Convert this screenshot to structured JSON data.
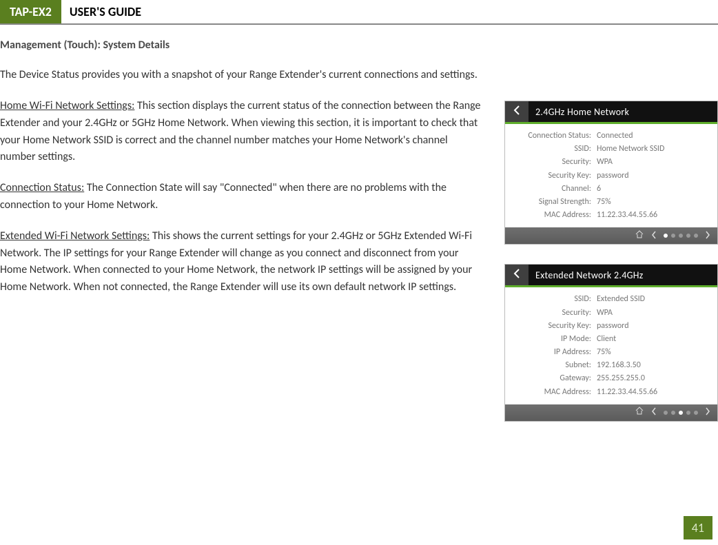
{
  "header": {
    "badge": "TAP-EX2",
    "title": "USER'S GUIDE"
  },
  "section_title": "Management (Touch): System Details",
  "intro": "The Device Status provides you with a snapshot of your Range Extender's current connections and settings.",
  "paras": {
    "p1_label": "Home Wi-Fi Network Settings:",
    "p1_text": " This section displays the current status of the connection between the Range Extender and your 2.4GHz or 5GHz Home Network. When viewing this section, it is important to check that your Home Network SSID is correct and the channel number matches your Home Network's channel number settings.",
    "p2_label": "Connection Status:",
    "p2_text": " The Connection State will say \"Connected\" when there are no problems with the connection to your Home Network.",
    "p3_label": "Extended Wi-Fi Network Settings:",
    "p3_text": " This shows the current settings for your 2.4GHz or 5GHz Extended Wi-Fi Network. The IP settings for your Range Extender will change as you connect and disconnect from your Home Network. When connected to your Home Network, the network IP settings will be assigned by your Home Network. When not connected, the Range Extender will use its own default network IP settings."
  },
  "panel1": {
    "title": "2.4GHz Home Network",
    "rows": [
      {
        "k": "Connection Status:",
        "v": "Connected"
      },
      {
        "k": "SSID:",
        "v": "Home Network SSID"
      },
      {
        "k": "Security:",
        "v": "WPA"
      },
      {
        "k": "Security Key:",
        "v": "password"
      },
      {
        "k": "Channel:",
        "v": "6"
      },
      {
        "k": "Signal Strength:",
        "v": "75%"
      },
      {
        "k": "MAC Address:",
        "v": "11.22.33.44.55.66"
      }
    ],
    "active_dot": 0
  },
  "panel2": {
    "title": "Extended Network 2.4GHz",
    "rows": [
      {
        "k": "SSID:",
        "v": "Extended SSID"
      },
      {
        "k": "Security:",
        "v": "WPA"
      },
      {
        "k": "Security Key:",
        "v": "password"
      },
      {
        "k": "IP Mode:",
        "v": "Client"
      },
      {
        "k": "IP Address:",
        "v": "75%"
      },
      {
        "k": "Subnet:",
        "v": "192.168.3.50"
      },
      {
        "k": "Gateway:",
        "v": "255.255.255.0"
      },
      {
        "k": "MAC Address:",
        "v": "11.22.33.44.55.66"
      }
    ],
    "active_dot": 2
  },
  "page_number": "41"
}
